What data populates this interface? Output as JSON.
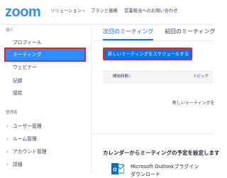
{
  "colors": {
    "brand": "#2d8cff",
    "accent": "#0e72ed",
    "highlight_border": "#e02828",
    "outlook_blue": "#0072c6"
  },
  "header": {
    "logo": "zoom",
    "nav": [
      {
        "label": "ソリューション",
        "has_dropdown": true
      },
      {
        "label": "プランと価格",
        "has_dropdown": false
      },
      {
        "label": "営業担当へのお問い合わせ",
        "has_dropdown": false
      }
    ]
  },
  "sidebar": {
    "personal_title": "個人",
    "personal_items": [
      {
        "label": "プロフィール",
        "active": false
      },
      {
        "label": "ミーティング",
        "active": true
      },
      {
        "label": "ウェビナー",
        "active": false
      },
      {
        "label": "記録",
        "active": false
      },
      {
        "label": "設定",
        "active": false
      }
    ],
    "admin_title": "管理者",
    "admin_items": [
      {
        "label": "ユーザー管理",
        "icon": "chevron-right-icon"
      },
      {
        "label": "ルーム管理",
        "icon": "chevron-right-icon"
      },
      {
        "label": "アカウント管理",
        "icon": "chevron-right-icon"
      },
      {
        "label": "詳細",
        "icon": "chevron-right-icon"
      }
    ]
  },
  "main": {
    "tabs": [
      {
        "label": "次回のミーティング",
        "active": true
      },
      {
        "label": "前回のミーティング",
        "active": false
      }
    ],
    "schedule_button": "新しいミーティングをスケジュールする",
    "table": {
      "columns": [
        "開始時間",
        "トピック"
      ]
    },
    "empty_message": "新しいミーティングを",
    "calendar_heading": "カレンダーからミーティングの予定を設定します",
    "plugin": {
      "icon": "outlook-icon",
      "line1": "Microsoft Outlookプラグイン",
      "line2": "ダウンロード"
    }
  }
}
